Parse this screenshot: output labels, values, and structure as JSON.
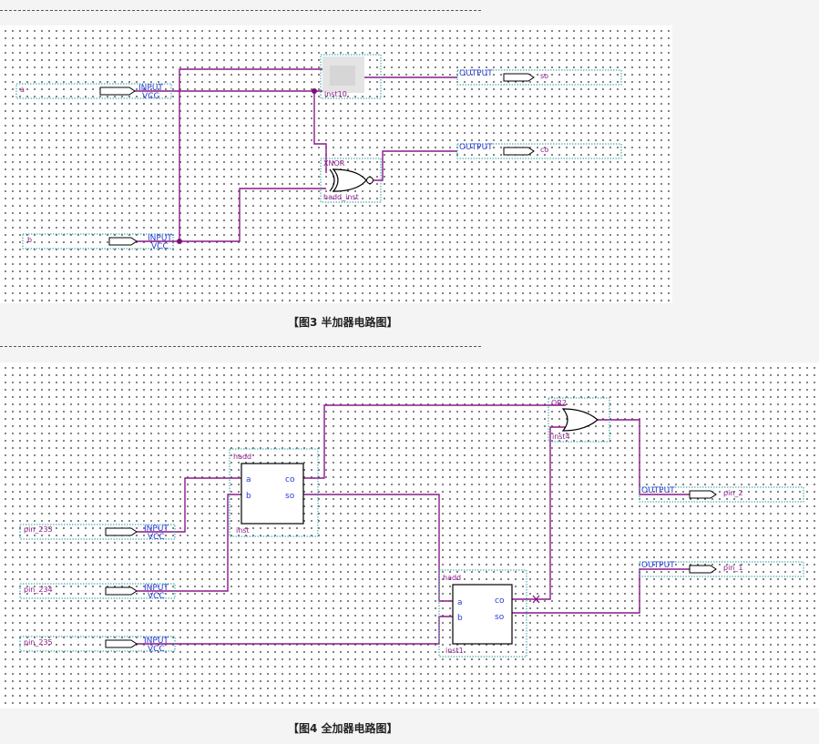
{
  "figure3": {
    "caption": "【图3 半加器电路图】",
    "pins": {
      "a_name": "a",
      "b_name": "b",
      "input_label": "INPUT",
      "vcc_label": "VCC",
      "output_label": "OUTPUT",
      "so_name": "so",
      "co_name": "co"
    },
    "gates": {
      "inst10_name": "inst10",
      "xnor_type": "XNOR",
      "xnor_name": "hadd_inst"
    }
  },
  "figure4": {
    "caption": "【图4 全加器电路图】",
    "inputs": [
      "pin_233",
      "pin_234",
      "pin_235"
    ],
    "outputs": [
      "pin_2",
      "pin_1"
    ],
    "input_label": "INPUT",
    "vcc_label": "VCC",
    "output_label": "OUTPUT",
    "hadd_blocks": [
      {
        "title": "hadd",
        "port_a": "a",
        "port_b": "b",
        "port_co": "co",
        "port_so": "so",
        "instance": "inst"
      },
      {
        "title": "hadd",
        "port_a": "a",
        "port_b": "b",
        "port_co": "co",
        "port_so": "so",
        "instance": "inst1"
      }
    ],
    "or_gate": {
      "type": "OR2",
      "instance": "inst4"
    }
  }
}
